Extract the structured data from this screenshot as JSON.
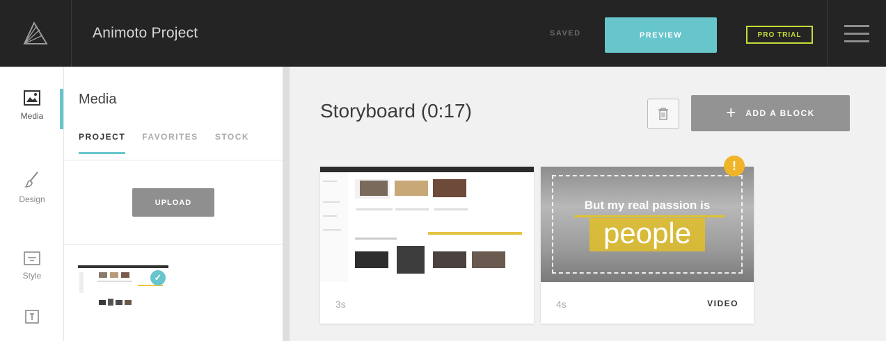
{
  "app": {
    "title": "Animoto Project",
    "status": "SAVED",
    "preview_label": "PREVIEW",
    "pro_trial_label": "PRO TRIAL"
  },
  "rail": {
    "items": [
      {
        "label": "Media",
        "icon": "image-icon"
      },
      {
        "label": "Design",
        "icon": "brush-icon"
      },
      {
        "label": "Style",
        "icon": "style-icon"
      },
      {
        "label": "",
        "icon": "text-block-icon"
      }
    ]
  },
  "media": {
    "heading": "Media",
    "tabs": [
      {
        "label": "PROJECT",
        "active": true
      },
      {
        "label": "FAVORITES",
        "active": false
      },
      {
        "label": "STOCK",
        "active": false
      }
    ],
    "upload_label": "UPLOAD",
    "check_mark": "✓"
  },
  "storyboard": {
    "title": "Storyboard (0:17)",
    "add_block_label": "ADD A BLOCK",
    "add_block_plus": "+",
    "blocks": [
      {
        "duration": "3s",
        "type": ""
      },
      {
        "duration": "4s",
        "type": "VIDEO",
        "caption_line1": "But my real passion is",
        "caption_line2": "people",
        "warning": "!"
      }
    ]
  },
  "colors": {
    "topbar": "#242424",
    "accent": "#67c5cc",
    "pro_trial": "#c9dc3a",
    "warning": "#f0b429"
  }
}
